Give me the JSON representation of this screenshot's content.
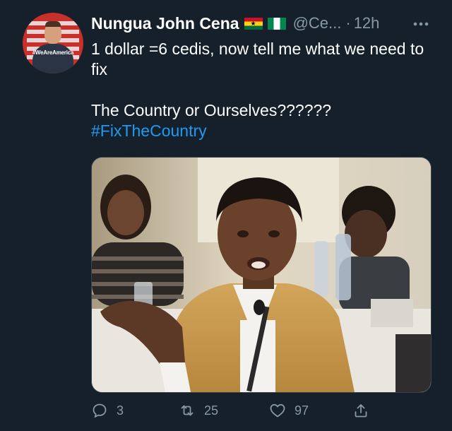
{
  "tweet": {
    "avatar": {
      "badge_text": "#WeAreAmerica"
    },
    "author": {
      "display_name": "Nungua John Cena",
      "flags": [
        "ghana-flag",
        "nigeria-flag"
      ],
      "handle": "@Ce...",
      "separator": "·",
      "timestamp": "12h"
    },
    "text": {
      "line1": "1 dollar =6 cedis, now tell me what we need to fix",
      "line2": "The Country or Ourselves??????",
      "hashtag": "#FixTheCountry"
    },
    "actions": {
      "reply": {
        "icon": "reply-icon",
        "count": "3"
      },
      "retweet": {
        "icon": "retweet-icon",
        "count": "25"
      },
      "like": {
        "icon": "heart-icon",
        "count": "97"
      },
      "share": {
        "icon": "share-icon"
      }
    }
  },
  "colors": {
    "background": "#15202b",
    "primary_text": "#ffffff",
    "secondary_text": "#8899a6",
    "link": "#1d9bf0"
  }
}
